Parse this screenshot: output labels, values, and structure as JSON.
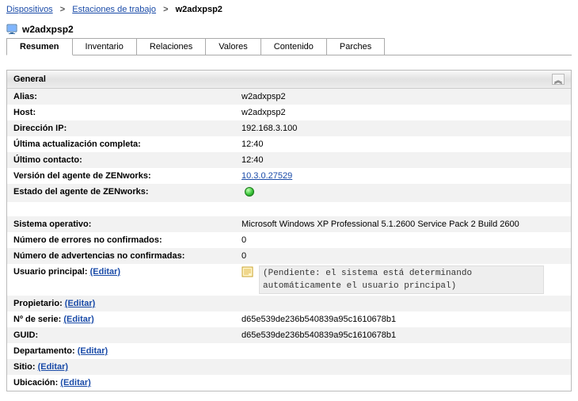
{
  "breadcrumb": {
    "level1": "Dispositivos",
    "level2": "Estaciones de trabajo",
    "current": "w2adxpsp2"
  },
  "page_title": "w2adxpsp2",
  "tabs": {
    "resumen": "Resumen",
    "inventario": "Inventario",
    "relaciones": "Relaciones",
    "valores": "Valores",
    "contenido": "Contenido",
    "parches": "Parches"
  },
  "panel": {
    "title": "General",
    "collapse_glyph": "︽"
  },
  "labels": {
    "alias": "Alias:",
    "host": "Host:",
    "ip": "Dirección IP:",
    "last_full_update": "Última actualización completa:",
    "last_contact": "Último contacto:",
    "agent_version": "Versión del agente de ZENworks:",
    "agent_status": "Estado del agente de ZENworks:",
    "os": "Sistema operativo:",
    "unack_errors": "Número de errores no confirmados:",
    "unack_warnings": "Número de advertencias no confirmadas:",
    "primary_user": "Usuario principal:",
    "owner": "Propietario:",
    "serial": "Nº de serie:",
    "guid": "GUID:",
    "department": "Departamento:",
    "site": "Sitio:",
    "location": "Ubicación:"
  },
  "edit_label": "(Editar)",
  "values": {
    "alias": "w2adxpsp2",
    "host": "w2adxpsp2",
    "ip": "192.168.3.100",
    "last_full_update": "12:40",
    "last_contact": "12:40",
    "agent_version": "10.3.0.27529",
    "os": "Microsoft Windows XP Professional 5.1.2600 Service Pack 2 Build 2600",
    "unack_errors": "0",
    "unack_warnings": "0",
    "primary_user_pending": "(Pendiente: el sistema está determinando automáticamente el usuario principal)",
    "serial": "d65e539de236b540839a95c1610678b1",
    "guid": "d65e539de236b540839a95c1610678b1"
  }
}
